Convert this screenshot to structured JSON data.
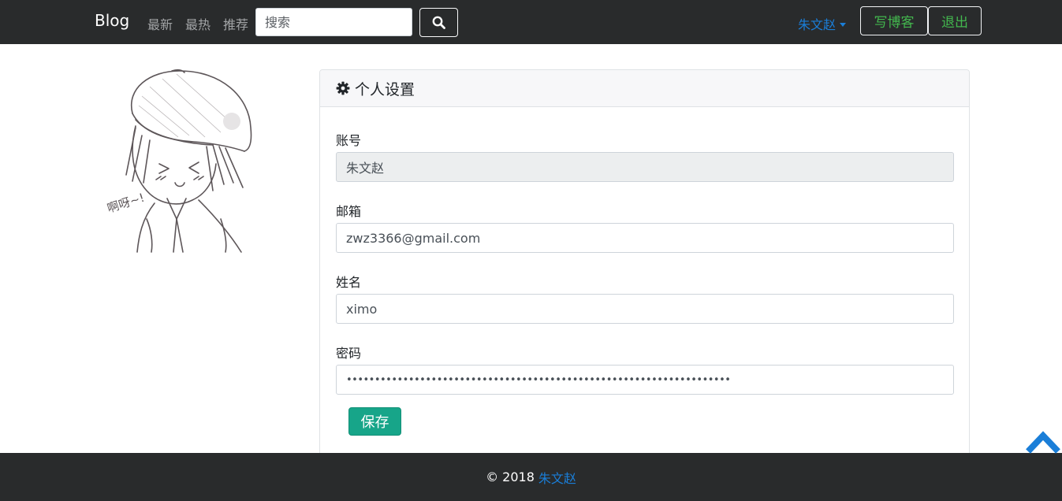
{
  "navbar": {
    "brand": "Blog",
    "links": [
      "最新",
      "最热",
      "推荐"
    ],
    "search_placeholder": "搜索",
    "search_icon": "search-icon",
    "user_name": "朱文赵",
    "write_label": "写博客",
    "logout_label": "退出"
  },
  "colors": {
    "navbar_bg": "#292b2c",
    "link_blue": "#1a7ed8",
    "outline_green": "#43b74e",
    "save_green": "#17a589"
  },
  "settings": {
    "header_icon": "gear-icon",
    "title": "个人设置",
    "account_label": "账号",
    "account_value": "朱文赵",
    "email_label": "邮箱",
    "email_value": "zwz3366@gmail.com",
    "name_label": "姓名",
    "name_value": "ximo",
    "password_label": "密码",
    "password_value": "••••••••••••••••••••••••••••••••••••••••••••••••••••••••••••••••••••",
    "save_label": "保存"
  },
  "avatar": {
    "caption": "啊呀~!"
  },
  "footer": {
    "copyright": "© 2018",
    "author": "朱文赵"
  },
  "back_to_top_icon": "chevron-up-icon"
}
